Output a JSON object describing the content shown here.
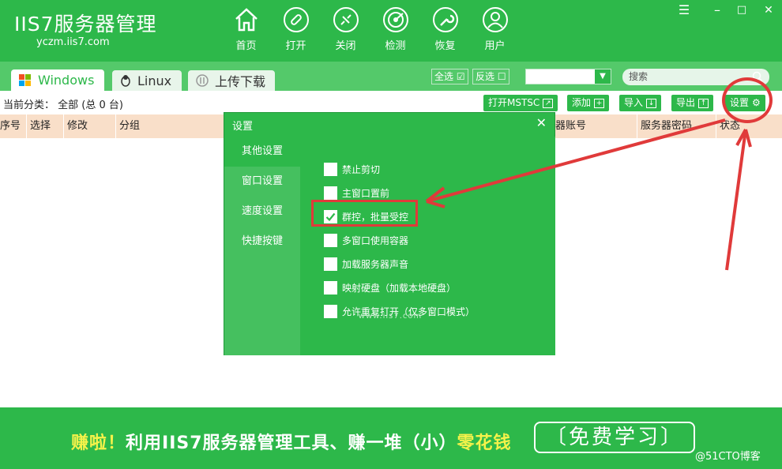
{
  "app": {
    "logo_name": "IIS7服务器管理",
    "logo_url": "yczm.iis7.com"
  },
  "nav": [
    {
      "label": "首页",
      "icon": "home-icon"
    },
    {
      "label": "打开",
      "icon": "link-icon"
    },
    {
      "label": "关闭",
      "icon": "unlink-icon"
    },
    {
      "label": "检测",
      "icon": "radar-icon"
    },
    {
      "label": "恢复",
      "icon": "wrench-icon"
    },
    {
      "label": "用户",
      "icon": "user-icon"
    }
  ],
  "window_controls": {
    "menu": "☰",
    "minimize": "–",
    "maximize": "□",
    "close": "✕"
  },
  "tabs": [
    {
      "label": "Windows",
      "icon": "windows-icon"
    },
    {
      "label": "Linux",
      "icon": "linux-icon"
    },
    {
      "label": "上传下载",
      "icon": "transfer-icon"
    }
  ],
  "toolbar": {
    "select_all": "全选",
    "invert": "反选",
    "dropdown_value": "",
    "search_placeholder": "搜索"
  },
  "category": {
    "label": "当前分类：",
    "value": "全部 (总 0 台)"
  },
  "actions": {
    "mstsc": "打开MSTSC",
    "add": "添加",
    "import": "导入",
    "export": "导出",
    "settings": "设置"
  },
  "columns": [
    "序号",
    "选择",
    "修改",
    "分组",
    "器账号",
    "服务器密码",
    "状态"
  ],
  "dialog": {
    "title": "设置",
    "close": "✕",
    "side": [
      "其他设置",
      "窗口设置",
      "速度设置",
      "快捷按键"
    ],
    "options": [
      {
        "label": "禁止剪切",
        "checked": false
      },
      {
        "label": "主窗口置前",
        "checked": false
      },
      {
        "label": "群控，批量受控",
        "checked": true
      },
      {
        "label": "多窗口使用容器",
        "checked": false
      },
      {
        "label": "加载服务器声音",
        "checked": false
      },
      {
        "label": "映射硬盘（加载本地硬盘）",
        "checked": false
      },
      {
        "label": "允许重复打开（仅多窗口模式）",
        "checked": false
      }
    ],
    "footer": "www.iis7.com"
  },
  "banner": {
    "prefix": "赚啦！",
    "middle": "利用IIS7服务器管理工具、赚一堆（小）",
    "suffix": "零花钱",
    "button": "〔免费学习〕",
    "watermark": "@51CTO博客"
  },
  "colors": {
    "brand_green": "#2db84a",
    "header_row": "#f9dfc9",
    "annotation_red": "#e03a3a",
    "banner_yellow": "#f5f24a"
  }
}
